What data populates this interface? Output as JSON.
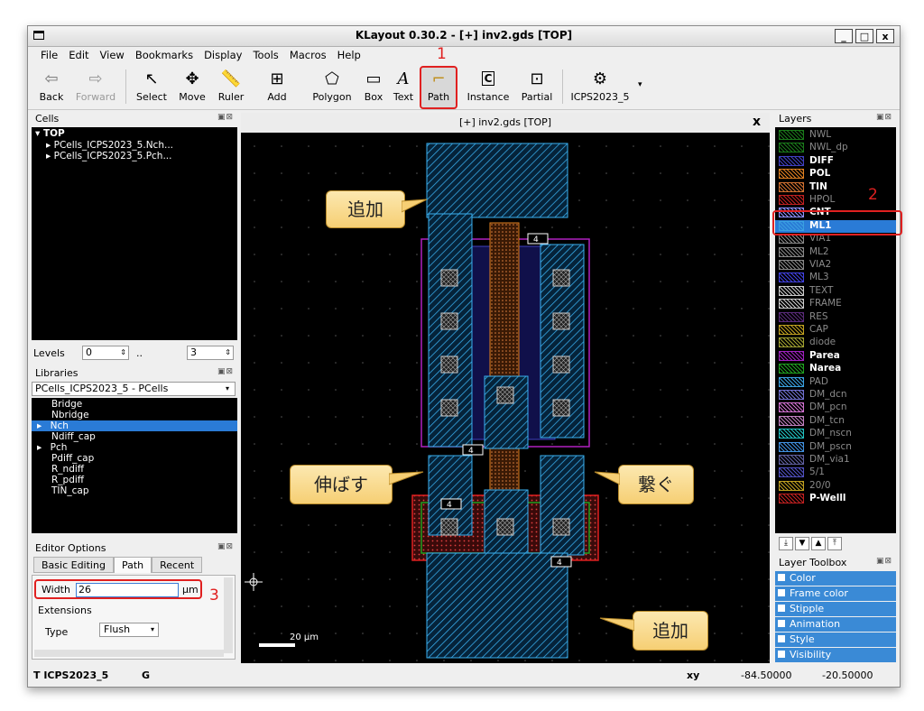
{
  "window": {
    "title": "KLayout 0.30.2 - [+] inv2.gds [TOP]",
    "buttons": [
      "_",
      "□",
      "x"
    ]
  },
  "menu": [
    "File",
    "Edit",
    "View",
    "Bookmarks",
    "Display",
    "Tools",
    "Macros",
    "Help"
  ],
  "toolbar": {
    "back": "Back",
    "forward": "Forward",
    "select": "Select",
    "move": "Move",
    "ruler": "Ruler",
    "add": "Add",
    "polygon": "Polygon",
    "box": "Box",
    "text": "Text",
    "path": "Path",
    "instance": "Instance",
    "partial": "Partial",
    "icps": "ICPS2023_5"
  },
  "cells": {
    "title": "Cells",
    "items": [
      "TOP",
      "PCells_ICPS2023_5.Nch...",
      "PCells_ICPS2023_5.Pch..."
    ]
  },
  "levels": {
    "label": "Levels",
    "from": "0",
    "sep": "..",
    "to": "3"
  },
  "libraries": {
    "title": "Libraries",
    "selected": "PCells_ICPS2023_5 - PCells",
    "items": [
      "Bridge",
      "Nbridge",
      "Nch",
      "Ndiff_cap",
      "Pch",
      "Pdiff_cap",
      "R_ndiff",
      "R_pdiff",
      "TIN_cap"
    ]
  },
  "editor": {
    "title": "Editor Options",
    "tabs": [
      "Basic Editing",
      "Path",
      "Recent"
    ],
    "width_label": "Width",
    "width_value": "26",
    "unit": "μm",
    "extensions": "Extensions",
    "type_label": "Type",
    "type_value": "Flush"
  },
  "canvas": {
    "tab_title": "[+] inv2.gds [TOP]",
    "close": "x",
    "scale": "20 μm",
    "labels": [
      "4",
      "4",
      "4",
      "4"
    ]
  },
  "callouts": {
    "c1": "追加",
    "c2": "伸ばす",
    "c3": "繋ぐ",
    "c4": "追加"
  },
  "annotations": {
    "n1": "1",
    "n2": "2",
    "n3": "3"
  },
  "layers": {
    "title": "Layers",
    "items": [
      {
        "name": "NWL",
        "bold": false,
        "dim": true,
        "color": "#1a7a1a"
      },
      {
        "name": "NWL_dp",
        "bold": false,
        "dim": true,
        "color": "#1a7a1a"
      },
      {
        "name": "DIFF",
        "bold": true,
        "dim": false,
        "color": "#4040c0"
      },
      {
        "name": "POL",
        "bold": true,
        "dim": false,
        "color": "#e08020"
      },
      {
        "name": "TIN",
        "bold": true,
        "dim": false,
        "color": "#d07030"
      },
      {
        "name": "HPOL",
        "bold": false,
        "dim": true,
        "color": "#c02020"
      },
      {
        "name": "CNT",
        "bold": true,
        "dim": false,
        "color": "#9090ff"
      },
      {
        "name": "ML1",
        "bold": true,
        "dim": false,
        "color": "#3aa0e0"
      },
      {
        "name": "VIA1",
        "bold": false,
        "dim": true,
        "color": "#888888"
      },
      {
        "name": "ML2",
        "bold": false,
        "dim": true,
        "color": "#888888"
      },
      {
        "name": "VIA2",
        "bold": false,
        "dim": true,
        "color": "#888888"
      },
      {
        "name": "ML3",
        "bold": false,
        "dim": true,
        "color": "#4040e0"
      },
      {
        "name": "TEXT",
        "bold": false,
        "dim": true,
        "color": "#cccccc"
      },
      {
        "name": "FRAME",
        "bold": false,
        "dim": true,
        "color": "#cccccc"
      },
      {
        "name": "RES",
        "bold": false,
        "dim": true,
        "color": "#5a2a7a"
      },
      {
        "name": "CAP",
        "bold": false,
        "dim": true,
        "color": "#c0a020"
      },
      {
        "name": "diode",
        "bold": false,
        "dim": true,
        "color": "#a0a030"
      },
      {
        "name": "Parea",
        "bold": true,
        "dim": false,
        "color": "#a020c0"
      },
      {
        "name": "Narea",
        "bold": true,
        "dim": false,
        "color": "#20a020"
      },
      {
        "name": "PAD",
        "bold": false,
        "dim": true,
        "color": "#3aa0e0"
      },
      {
        "name": "DM_dcn",
        "bold": false,
        "dim": true,
        "color": "#7070d0"
      },
      {
        "name": "DM_pcn",
        "bold": false,
        "dim": true,
        "color": "#d070d0"
      },
      {
        "name": "DM_tcn",
        "bold": false,
        "dim": true,
        "color": "#c080c0"
      },
      {
        "name": "DM_nscn",
        "bold": false,
        "dim": true,
        "color": "#20c0c0"
      },
      {
        "name": "DM_pscn",
        "bold": false,
        "dim": true,
        "color": "#4090e0"
      },
      {
        "name": "DM_via1",
        "bold": false,
        "dim": true,
        "color": "#6060a0"
      },
      {
        "name": "5/1",
        "bold": false,
        "dim": true,
        "color": "#5050c0"
      },
      {
        "name": "20/0",
        "bold": false,
        "dim": true,
        "color": "#c0a020"
      },
      {
        "name": "P-Welll",
        "bold": true,
        "dim": false,
        "color": "#c02020"
      }
    ]
  },
  "toolbox": {
    "title": "Layer Toolbox",
    "items": [
      "Color",
      "Frame color",
      "Stipple",
      "Animation",
      "Style",
      "Visibility"
    ]
  },
  "status": {
    "left": "T ICPS2023_5",
    "mid": "G",
    "xy_label": "xy",
    "x": "-84.50000",
    "y": "-20.50000"
  }
}
